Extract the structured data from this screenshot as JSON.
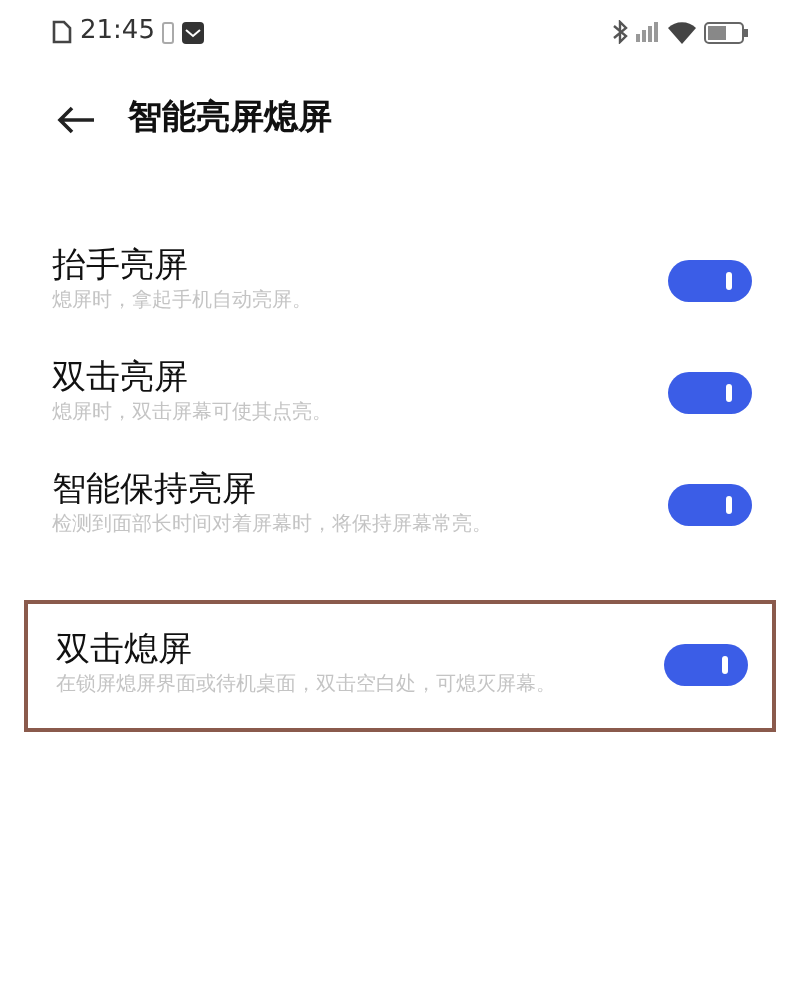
{
  "status_bar": {
    "time": "21:45"
  },
  "header": {
    "title": "智能亮屏熄屏"
  },
  "settings": [
    {
      "title": "抬手亮屏",
      "description": "熄屏时，拿起手机自动亮屏。",
      "on": true,
      "highlighted": false
    },
    {
      "title": "双击亮屏",
      "description": "熄屏时，双击屏幕可使其点亮。",
      "on": true,
      "highlighted": false
    },
    {
      "title": "智能保持亮屏",
      "description": "检测到面部长时间对着屏幕时，将保持屏幕常亮。",
      "on": true,
      "highlighted": false
    },
    {
      "title": "双击熄屏",
      "description": "在锁屏熄屏界面或待机桌面，双击空白处，可熄灭屏幕。",
      "on": true,
      "highlighted": true
    }
  ]
}
